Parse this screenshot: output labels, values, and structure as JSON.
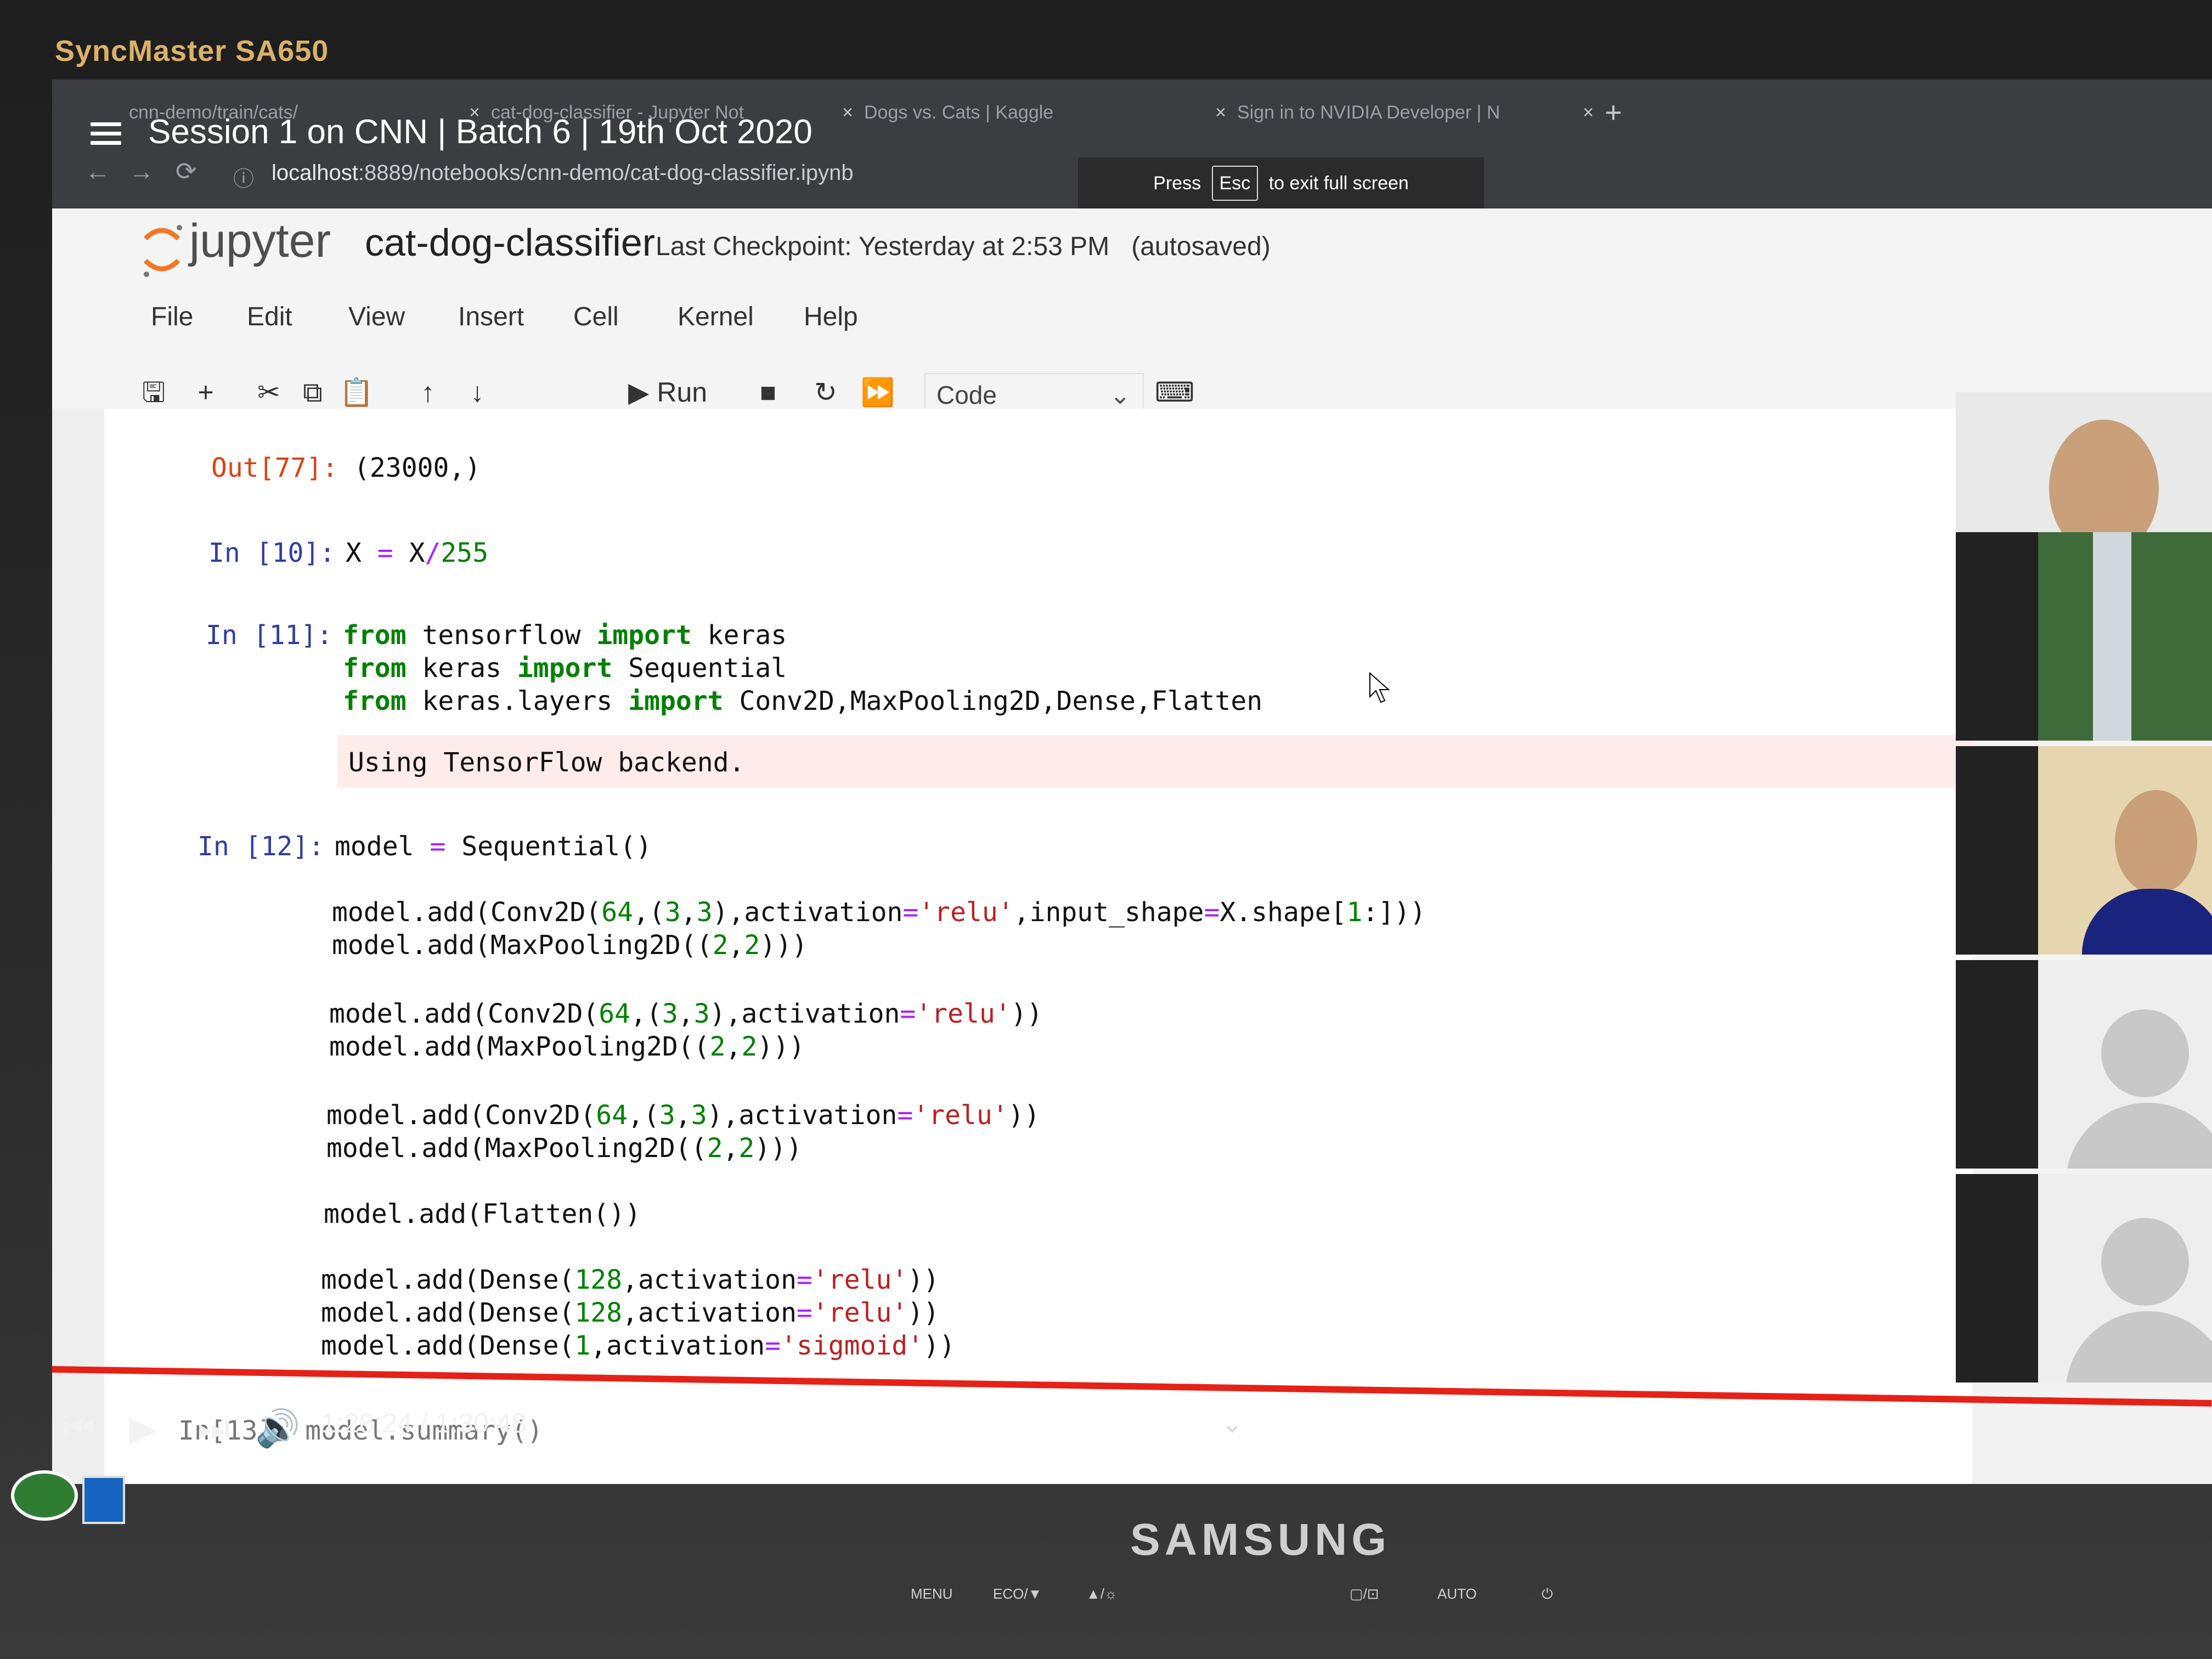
{
  "monitor": {
    "brand_top": "SyncMaster SA650",
    "brand_bottom": "SAMSUNG",
    "buttons": [
      "MENU",
      "ECO/▼",
      "▲/☼",
      "▢/⊡",
      "AUTO",
      "⏻"
    ]
  },
  "browser": {
    "tabs": [
      {
        "label": "cnn-demo/train/cats/",
        "close": "×"
      },
      {
        "label": "cat-dog-classifier - Jupyter Not",
        "close": "×"
      },
      {
        "label": "Dogs vs. Cats | Kaggle",
        "close": "×"
      },
      {
        "label": "Sign in to NVIDIA Developer | N",
        "close": "×"
      }
    ],
    "new_tab": "+",
    "video_title": "Session 1 on CNN | Batch 6 | 19th Oct 2020",
    "url_host": "localhost",
    "url_rest": ":8889/notebooks/cnn-demo/cat-dog-classifier.ipynb",
    "fullscreen_press": "Press",
    "fullscreen_key": "Esc",
    "fullscreen_msg": "to exit full screen"
  },
  "jupyter": {
    "logo_text": "jupyter",
    "notebook_name": "cat-dog-classifier",
    "checkpoint": "Last Checkpoint: Yesterday at 2:53 PM",
    "autosaved": "(autosaved)",
    "menu": [
      "File",
      "Edit",
      "View",
      "Insert",
      "Cell",
      "Kernel",
      "Help"
    ],
    "toolbar": {
      "run_label": "Run",
      "cell_type": "Code"
    }
  },
  "cells": {
    "out77_prompt": "Out[77]:",
    "out77_value": "(23000,)",
    "in10_prompt": "In [10]:",
    "in11_prompt": "In [11]:",
    "in11_stderr": "Using TensorFlow backend.",
    "in12_prompt": "In [12]:"
  },
  "video": {
    "time": "1:28:24 / 1:30:48",
    "ghost_text": "In[13]: model.summary()"
  },
  "colors": {
    "progress": "#e62117",
    "keyword": "#008000",
    "string": "#ba2121",
    "prompt_in": "#303f9f",
    "prompt_out": "#d84315"
  }
}
